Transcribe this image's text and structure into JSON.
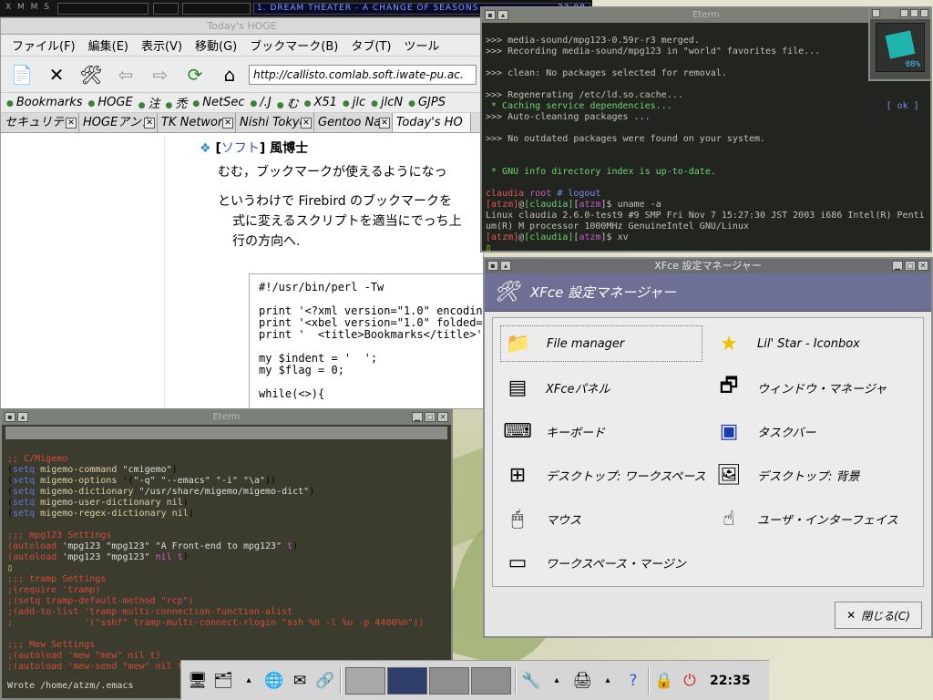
{
  "xmms": {
    "label": "X M M S",
    "song": "1. DREAM THEATER - A CHANGE OF SEASONS",
    "time": "23:08"
  },
  "firebird": {
    "title": "Today's HOGE",
    "menu": [
      "ファイル(F)",
      "編集(E)",
      "表示(V)",
      "移動(G)",
      "ブックマーク(B)",
      "タブ(T)",
      "ツール"
    ],
    "url": "http://callisto.comlab.soft.iwate-pu.ac.",
    "bookmarks": [
      "Bookmarks",
      "HOGE",
      "注",
      "禿",
      "NetSec",
      "/.J",
      "む",
      "X51",
      "jlc",
      "jlcN",
      "GJPS"
    ],
    "tabs": [
      "セキュリティ",
      "HOGEアンシ",
      "TK Networ",
      "Nishi Tokyo",
      "Gentoo Na",
      "Today's HO"
    ],
    "content": {
      "heading_bullet": "❖",
      "heading_open": "[",
      "heading_link": "ソフト",
      "heading_close": "]",
      "heading_title": "風博士",
      "p1": "むむ，ブックマークが使えるようになっ",
      "p2a": "というわけで Firebird のブックマークを",
      "p2b": "式に変えるスクリプトを適当にでっち上",
      "p2c": "行の方向へ.",
      "code": "#!/usr/bin/perl -Tw\n\nprint '<?xml version=\"1.0\" encoding=\nprint '<xbel version=\"1.0\" folded=\"n\nprint '  <title>Bookmarks</title>',\n\nmy $indent = '  ';\nmy $flag = 0;\n\nwhile(<>){"
    }
  },
  "eterm_top": {
    "title": "Eterm",
    "lines": [
      ">>> media-sound/mpg123-0.59r-r3 merged.",
      ">>> Recording media-sound/mpg123 in \"world\" favorites file...",
      "",
      ">>> clean: No packages selected for removal.",
      "",
      ">>> Regenerating /etc/ld.so.cache...",
      " * Caching service dependencies...",
      ">>> Auto-cleaning packages ...",
      "",
      ">>> No outdated packages were found on your system.",
      "",
      "",
      " * GNU info directory index is up-to-date."
    ],
    "ok": "[ ok ]",
    "prompt_host": "claudia",
    "prompt_user": "root",
    "prompt_cmd": "# logout",
    "prompt2_cmd": "uname -a",
    "uname1": "Linux claudia 2.6.0-test9 #9 SMP Fri Nov 7 15:27:30 JST 2003 i686 Intel(R) Penti",
    "uname2": "um(R) M processor 1000MHz GenuineIntel GNU/Linux",
    "prompt3_cmd": "xv",
    "atzm": "atzm",
    "host": "claudia"
  },
  "xosview": {
    "percent": "08%"
  },
  "eterm_emacs": {
    "title": "Eterm",
    "status": "Wrote /home/atzm/.emacs"
  },
  "xfce": {
    "title": "XFce 設定マネージャー",
    "header": "XFce 設定マネージャー",
    "items": [
      "File manager",
      "Lil' Star - Iconbox",
      "XFceパネル",
      "ウィンドウ・マネージャ",
      "キーボード",
      "タスクバー",
      "デスクトップ: ワークスペース",
      "デスクトップ: 背景",
      "マウス",
      "ユーザ・インターフェイス",
      "ワークスペース・マージン"
    ],
    "close": "閉じる(C)"
  },
  "taskbar": {
    "clock": "22:35"
  }
}
